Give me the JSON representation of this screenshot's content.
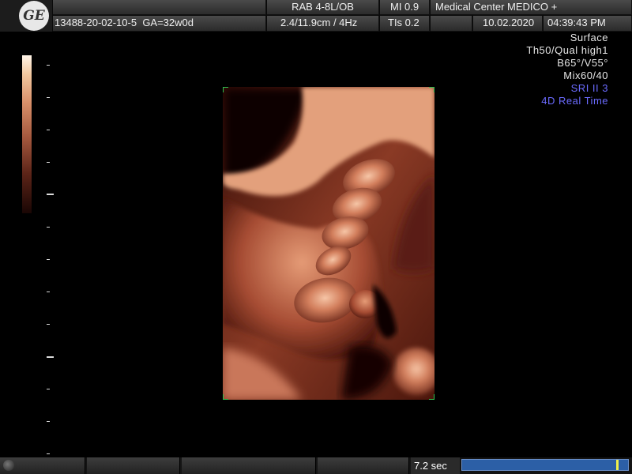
{
  "header": {
    "logo_text": "GE",
    "patient_id": "13488-20-02-10-5",
    "gestational_age": "GA=32w0d",
    "probe": "RAB 4-8L/OB",
    "depth_freq": "2.4/11.9cm /  4Hz",
    "mi": "MI  0.9",
    "tis": "TIs  0.2",
    "institution": "Medical Center MEDICO +",
    "date": "10.02.2020",
    "time": "04:39:43 PM"
  },
  "params": [
    {
      "text": "Surface",
      "color": "#e6e6e6"
    },
    {
      "text": "Th50/Qual high1",
      "color": "#e6e6e6"
    },
    {
      "text": "B65°/V55°",
      "color": "#e6e6e6"
    },
    {
      "text": "Mix60/40",
      "color": "#e6e6e6"
    },
    {
      "text": "SRI II 3",
      "color": "#6b6bff"
    },
    {
      "text": "4D Real Time",
      "color": "#6b6bff"
    }
  ],
  "footer": {
    "cine_time": "7.2 sec",
    "cine_position": 0.94
  },
  "colors": {
    "cine_bar": "#2c5fa6",
    "cine_marker": "#f1f14a",
    "roi_corner": "#2fbf4f",
    "render_tint": "#b5593f"
  },
  "icons": [
    "ge-logo-icon",
    "trackball-knob-icon"
  ]
}
